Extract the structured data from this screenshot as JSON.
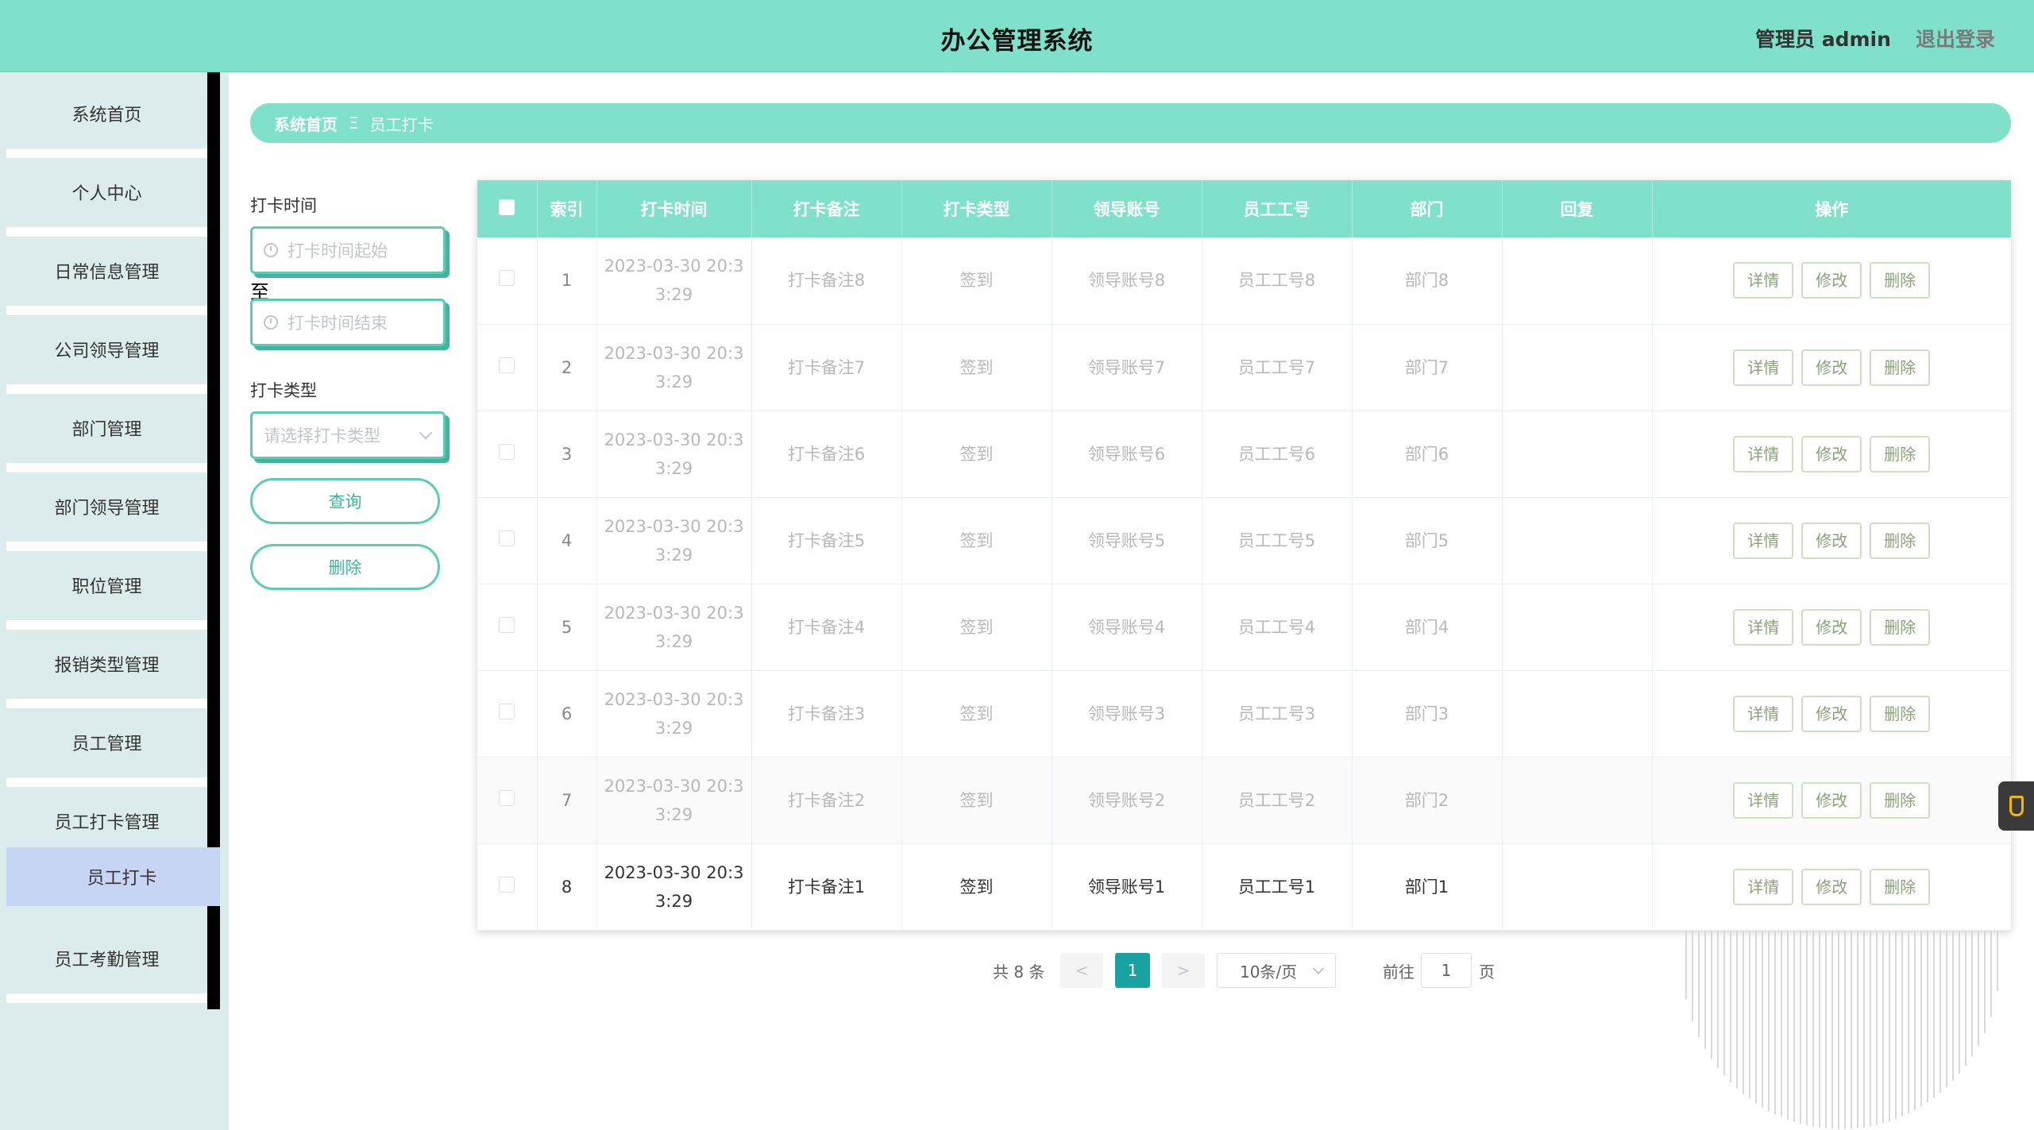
{
  "header": {
    "title": "办公管理系统",
    "user": "管理员 admin",
    "logout": "退出登录"
  },
  "sidebar": {
    "items": [
      "系统首页",
      "个人中心",
      "日常信息管理",
      "公司领导管理",
      "部门管理",
      "部门领导管理",
      "职位管理",
      "报销类型管理",
      "员工管理",
      "员工打卡管理",
      "员工考勤管理"
    ],
    "active_sub": "员工打卡"
  },
  "breadcrumb": {
    "home": "系统首页",
    "sep": "Ξ",
    "current": "员工打卡"
  },
  "search": {
    "time_label": "打卡时间",
    "start_placeholder": "打卡时间起始",
    "to": "至",
    "end_placeholder": "打卡时间结束",
    "type_label": "打卡类型",
    "type_placeholder": "请选择打卡类型",
    "query_button": "查询",
    "delete_button": "删除"
  },
  "table": {
    "columns": [
      "索引",
      "打卡时间",
      "打卡备注",
      "打卡类型",
      "领导账号",
      "员工工号",
      "部门",
      "回复",
      "操作"
    ],
    "rows": [
      {
        "idx": "1",
        "time1": "2023-03-30 20:3",
        "time2": "3:29",
        "note": "打卡备注8",
        "type": "签到",
        "leader": "领导账号8",
        "emp": "员工工号8",
        "dept": "部门8",
        "reply": ""
      },
      {
        "idx": "2",
        "time1": "2023-03-30 20:3",
        "time2": "3:29",
        "note": "打卡备注7",
        "type": "签到",
        "leader": "领导账号7",
        "emp": "员工工号7",
        "dept": "部门7",
        "reply": ""
      },
      {
        "idx": "3",
        "time1": "2023-03-30 20:3",
        "time2": "3:29",
        "note": "打卡备注6",
        "type": "签到",
        "leader": "领导账号6",
        "emp": "员工工号6",
        "dept": "部门6",
        "reply": ""
      },
      {
        "idx": "4",
        "time1": "2023-03-30 20:3",
        "time2": "3:29",
        "note": "打卡备注5",
        "type": "签到",
        "leader": "领导账号5",
        "emp": "员工工号5",
        "dept": "部门5",
        "reply": ""
      },
      {
        "idx": "5",
        "time1": "2023-03-30 20:3",
        "time2": "3:29",
        "note": "打卡备注4",
        "type": "签到",
        "leader": "领导账号4",
        "emp": "员工工号4",
        "dept": "部门4",
        "reply": ""
      },
      {
        "idx": "6",
        "time1": "2023-03-30 20:3",
        "time2": "3:29",
        "note": "打卡备注3",
        "type": "签到",
        "leader": "领导账号3",
        "emp": "员工工号3",
        "dept": "部门3",
        "reply": ""
      },
      {
        "idx": "7",
        "time1": "2023-03-30 20:3",
        "time2": "3:29",
        "note": "打卡备注2",
        "type": "签到",
        "leader": "领导账号2",
        "emp": "员工工号2",
        "dept": "部门2",
        "reply": ""
      },
      {
        "idx": "8",
        "time1": "2023-03-30 20:3",
        "time2": "3:29",
        "note": "打卡备注1",
        "type": "签到",
        "leader": "领导账号1",
        "emp": "员工工号1",
        "dept": "部门1",
        "reply": ""
      }
    ],
    "actions": [
      "详情",
      "修改",
      "删除"
    ]
  },
  "pagination": {
    "total": "共 8 条",
    "prev": "<",
    "page": "1",
    "next": ">",
    "size": "10条/页",
    "goto": "前往",
    "goto_value": "1",
    "page_unit": "页"
  },
  "colors": {
    "accent": "#80e1cb",
    "accent_dark": "#3fb59d",
    "active_bg": "#c8d4f4",
    "page_active": "#1aa1a1"
  }
}
